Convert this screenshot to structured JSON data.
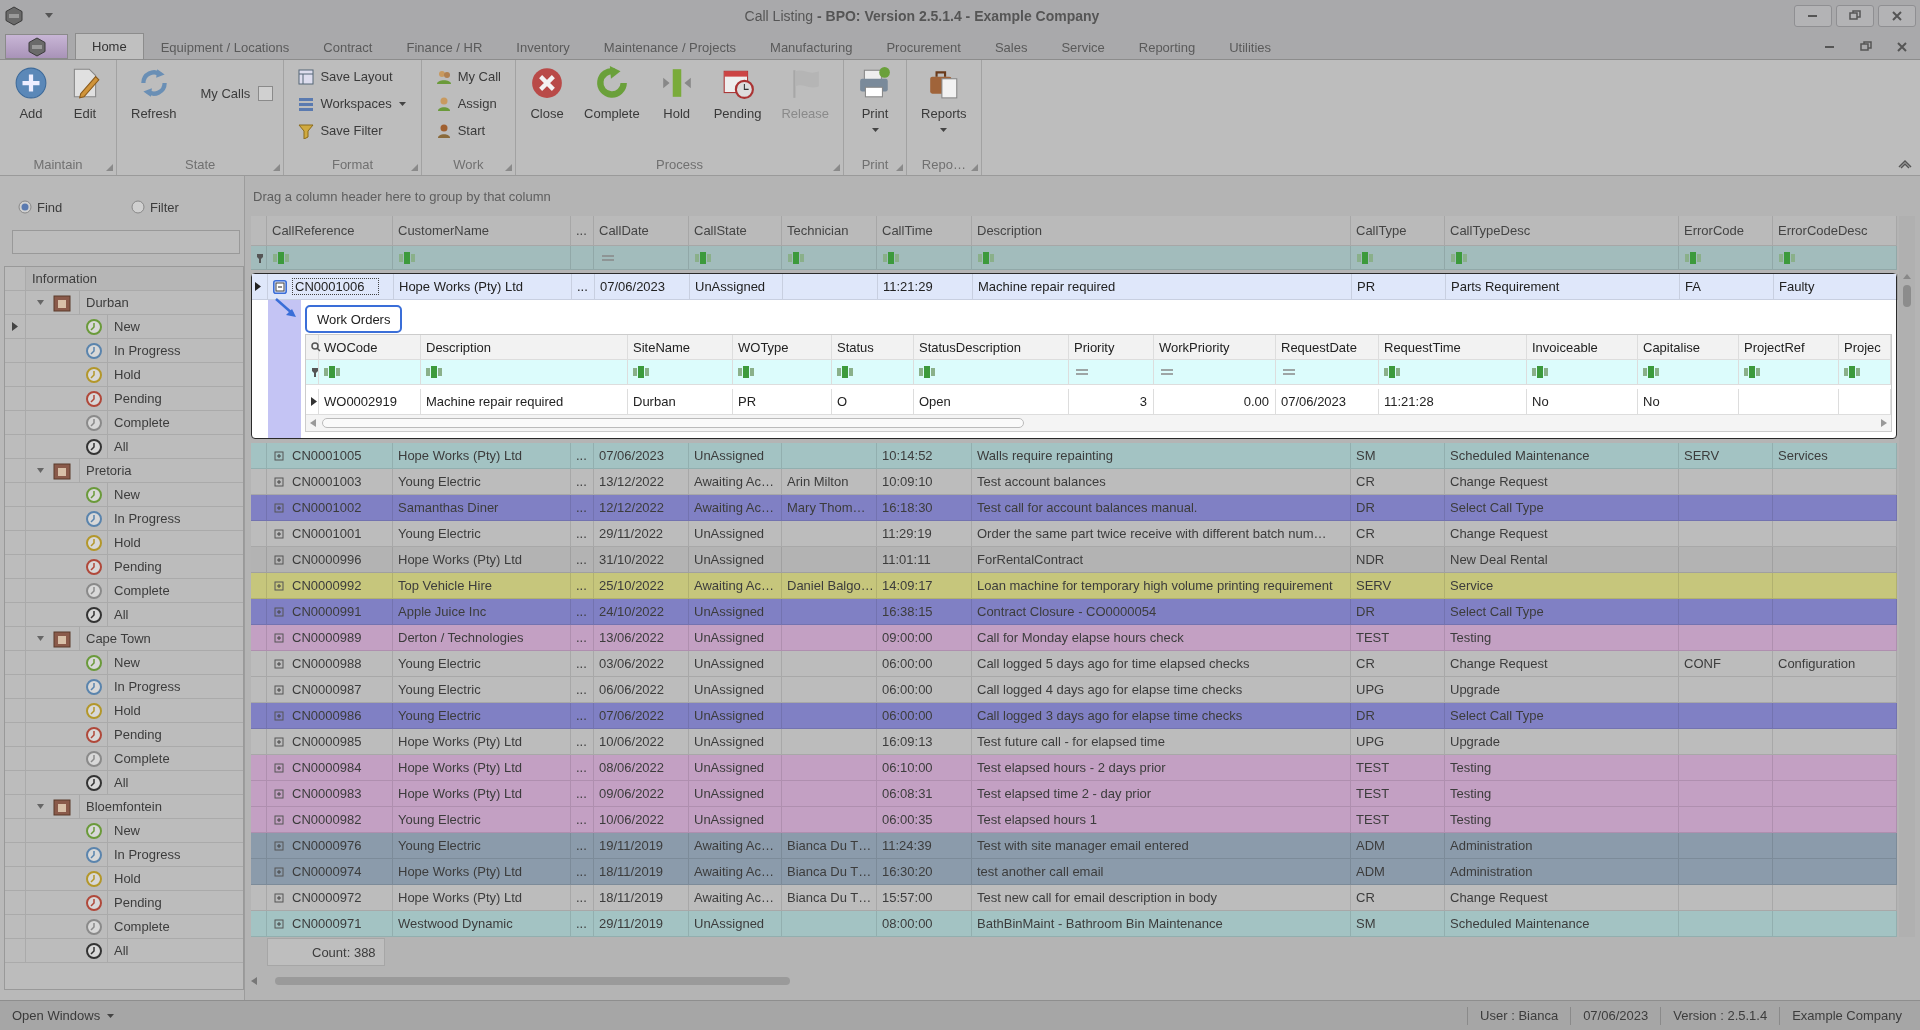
{
  "window": {
    "title": "Call Listing **- BPO: Version 2.5.1.4 - Example Company**"
  },
  "menu_tabs": [
    {
      "label": "Home",
      "selected": true
    },
    {
      "label": "Equipment / Locations",
      "selected": false
    },
    {
      "label": "Contract",
      "selected": false
    },
    {
      "label": "Finance / HR",
      "selected": false
    },
    {
      "label": "Inventory",
      "selected": false
    },
    {
      "label": "Maintenance / Projects",
      "selected": false
    },
    {
      "label": "Manufacturing",
      "selected": false
    },
    {
      "label": "Procurement",
      "selected": false
    },
    {
      "label": "Sales",
      "selected": false
    },
    {
      "label": "Service",
      "selected": false
    },
    {
      "label": "Reporting",
      "selected": false
    },
    {
      "label": "Utilities",
      "selected": false
    }
  ],
  "ribbon": {
    "groups": [
      {
        "label": "Maintain",
        "items": [
          {
            "kind": "large",
            "label": "Add",
            "disabled": false,
            "dropdown": false
          },
          {
            "kind": "large",
            "label": "Edit",
            "disabled": false,
            "dropdown": false
          }
        ]
      },
      {
        "label": "State",
        "items": [
          {
            "kind": "large",
            "label": "Refresh",
            "disabled": false,
            "dropdown": false
          },
          {
            "kind": "checkbox",
            "label": "My Calls",
            "checked": false
          }
        ]
      },
      {
        "label": "Format",
        "items": [
          {
            "kind": "small",
            "label": "Save Layout",
            "disabled": false,
            "dropdown": false
          },
          {
            "kind": "small",
            "label": "Workspaces",
            "disabled": false,
            "dropdown": true
          },
          {
            "kind": "small",
            "label": "Save Filter",
            "disabled": false,
            "dropdown": false
          }
        ]
      },
      {
        "label": "Work",
        "items": [
          {
            "kind": "small",
            "label": "My Call",
            "disabled": false,
            "dropdown": false
          },
          {
            "kind": "small",
            "label": "Assign",
            "disabled": false,
            "dropdown": false
          },
          {
            "kind": "small",
            "label": "Start",
            "disabled": false,
            "dropdown": false
          }
        ]
      },
      {
        "label": "Process",
        "items": [
          {
            "kind": "large",
            "label": "Close",
            "disabled": false,
            "dropdown": false
          },
          {
            "kind": "large",
            "label": "Complete",
            "disabled": false,
            "dropdown": false
          },
          {
            "kind": "large",
            "label": "Hold",
            "disabled": false,
            "dropdown": false
          },
          {
            "kind": "large",
            "label": "Pending",
            "disabled": false,
            "dropdown": false
          },
          {
            "kind": "large",
            "label": "Release",
            "disabled": true,
            "dropdown": false
          }
        ]
      },
      {
        "label": "Print",
        "items": [
          {
            "kind": "large",
            "label": "Print",
            "disabled": false,
            "dropdown": true
          }
        ]
      },
      {
        "label": "Repo…",
        "items": [
          {
            "kind": "large",
            "label": "Reports",
            "disabled": false,
            "dropdown": true
          }
        ]
      }
    ]
  },
  "side_panel": {
    "modes": [
      {
        "label": "Find",
        "selected": true
      },
      {
        "label": "Filter",
        "selected": false
      }
    ],
    "tree": {
      "header": "Information",
      "nodes": [
        {
          "label": "Durban",
          "expanded": true,
          "children": [
            {
              "label": "New",
              "color": "#6a9a3a",
              "selected": true
            },
            {
              "label": "In Progress",
              "color": "#5a84ad",
              "selected": false
            },
            {
              "label": "Hold",
              "color": "#b3972a",
              "selected": false
            },
            {
              "label": "Pending",
              "color": "#b0483a",
              "selected": false
            },
            {
              "label": "Complete",
              "color": "#8a8a8a",
              "selected": false
            },
            {
              "label": "All",
              "color": "#333333",
              "selected": false
            }
          ]
        },
        {
          "label": "Pretoria",
          "expanded": true,
          "children": [
            {
              "label": "New",
              "color": "#6a9a3a",
              "selected": false
            },
            {
              "label": "In Progress",
              "color": "#5a84ad",
              "selected": false
            },
            {
              "label": "Hold",
              "color": "#b3972a",
              "selected": false
            },
            {
              "label": "Pending",
              "color": "#b0483a",
              "selected": false
            },
            {
              "label": "Complete",
              "color": "#8a8a8a",
              "selected": false
            },
            {
              "label": "All",
              "color": "#333333",
              "selected": false
            }
          ]
        },
        {
          "label": "Cape Town",
          "expanded": true,
          "children": [
            {
              "label": "New",
              "color": "#6a9a3a",
              "selected": false
            },
            {
              "label": "In Progress",
              "color": "#5a84ad",
              "selected": false
            },
            {
              "label": "Hold",
              "color": "#b3972a",
              "selected": false
            },
            {
              "label": "Pending",
              "color": "#b0483a",
              "selected": false
            },
            {
              "label": "Complete",
              "color": "#8a8a8a",
              "selected": false
            },
            {
              "label": "All",
              "color": "#333333",
              "selected": false
            }
          ]
        },
        {
          "label": "Bloemfontein",
          "expanded": true,
          "children": [
            {
              "label": "New",
              "color": "#6a9a3a",
              "selected": false
            },
            {
              "label": "In Progress",
              "color": "#5a84ad",
              "selected": false
            },
            {
              "label": "Hold",
              "color": "#b3972a",
              "selected": false
            },
            {
              "label": "Pending",
              "color": "#b0483a",
              "selected": false
            },
            {
              "label": "Complete",
              "color": "#8a8a8a",
              "selected": false
            },
            {
              "label": "All",
              "color": "#333333",
              "selected": false
            }
          ]
        }
      ]
    }
  },
  "grid": {
    "group_hint": "Drag a column header here to group by that column",
    "columns": [
      {
        "label": "CallReference"
      },
      {
        "label": "CustomerName"
      },
      {
        "label": "..."
      },
      {
        "label": "CallDate"
      },
      {
        "label": "CallState"
      },
      {
        "label": "Technician"
      },
      {
        "label": "CallTime"
      },
      {
        "label": "Description"
      },
      {
        "label": "CallType"
      },
      {
        "label": "CallTypeDesc"
      },
      {
        "label": "ErrorCode"
      },
      {
        "label": "ErrorCodeDesc"
      }
    ],
    "filters": [
      {
        "kind": "text"
      },
      {
        "kind": "text"
      },
      {
        "kind": "none"
      },
      {
        "kind": "equals"
      },
      {
        "kind": "text"
      },
      {
        "kind": "text"
      },
      {
        "kind": "text"
      },
      {
        "kind": "text"
      },
      {
        "kind": "text"
      },
      {
        "kind": "text"
      },
      {
        "kind": "text"
      },
      {
        "kind": "text"
      }
    ],
    "rows": [
      {
        "expanded": true,
        "color": "#dfe7fa",
        "cells": {
          "reference": "CN0001006",
          "customer": "Hope Works (Pty) Ltd",
          "more": "...",
          "date": "07/06/2023",
          "state": "UnAssigned",
          "time": "11:21:29",
          "description": "Machine repair required",
          "type": "PR",
          "type_desc": "Parts Requirement",
          "error_code": "FA",
          "error_desc": "Faulty"
        },
        "detail": {
          "tabs": [
            {
              "label": "Work Orders",
              "selected": true
            }
          ],
          "columns": [
            {
              "label": "WOCode"
            },
            {
              "label": "Description"
            },
            {
              "label": "SiteName"
            },
            {
              "label": "WOType"
            },
            {
              "label": "Status"
            },
            {
              "label": "StatusDescription"
            },
            {
              "label": "Priority"
            },
            {
              "label": "WorkPriority"
            },
            {
              "label": "RequestDate"
            },
            {
              "label": "RequestTime"
            },
            {
              "label": "Invoiceable"
            },
            {
              "label": "Capitalise"
            },
            {
              "label": "ProjectRef"
            },
            {
              "label": "Projec"
            }
          ],
          "filters": [
            {
              "kind": "text"
            },
            {
              "kind": "text"
            },
            {
              "kind": "text"
            },
            {
              "kind": "text"
            },
            {
              "kind": "text"
            },
            {
              "kind": "text"
            },
            {
              "kind": "equals"
            },
            {
              "kind": "equals"
            },
            {
              "kind": "equals"
            },
            {
              "kind": "text"
            },
            {
              "kind": "text"
            },
            {
              "kind": "text"
            },
            {
              "kind": "text"
            },
            {
              "kind": "text"
            }
          ],
          "rows": [
            {
              "cells": {
                "wo_code": "WO0002919",
                "description": "Machine repair required",
                "site": "Durban",
                "wo_type": "PR",
                "status": "O",
                "status_desc": "Open",
                "priority": "3",
                "work_priority": "0.00",
                "request_date": "07/06/2023",
                "request_time": "11:21:28",
                "invoiceable": "No",
                "capitalise": "No"
              }
            }
          ]
        }
      },
      {
        "expanded": false,
        "color": "#a3c3c3",
        "cells": {
          "reference": "CN0001005",
          "customer": "Hope Works (Pty) Ltd",
          "more": "...",
          "date": "07/06/2023",
          "state": "UnAssigned",
          "time": "10:14:52",
          "description": "Walls require repainting",
          "type": "SM",
          "type_desc": "Scheduled Maintenance",
          "error_code": "SERV",
          "error_desc": "Services"
        }
      },
      {
        "expanded": false,
        "color": "#bcbcbc",
        "cells": {
          "reference": "CN0001003",
          "customer": "Young Electric",
          "more": "...",
          "date": "13/12/2022",
          "state": "Awaiting Ac…",
          "technician": "Arin Milton",
          "time": "10:09:10",
          "description": "Test account balances",
          "type": "CR",
          "type_desc": "Change Request"
        }
      },
      {
        "expanded": false,
        "color": "#8080c4",
        "cells": {
          "reference": "CN0001002",
          "customer": "Samanthas Diner",
          "more": "...",
          "date": "12/12/2022",
          "state": "Awaiting Ac…",
          "technician": "Mary Thom…",
          "time": "16:18:30",
          "description": "Test call for account balances manual.",
          "type": "DR",
          "type_desc": "Select Call Type"
        }
      },
      {
        "expanded": false,
        "color": "#bcbcbc",
        "cells": {
          "reference": "CN0001001",
          "customer": "Young Electric",
          "more": "...",
          "date": "29/11/2022",
          "state": "UnAssigned",
          "time": "11:29:19",
          "description": "Order the same part twice receive with different batch num…",
          "type": "CR",
          "type_desc": "Change Request"
        }
      },
      {
        "expanded": false,
        "color": "#b3b3b3",
        "cells": {
          "reference": "CN0000996",
          "customer": "Hope Works (Pty) Ltd",
          "more": "...",
          "date": "31/10/2022",
          "state": "UnAssigned",
          "time": "11:01:11",
          "description": "ForRentalContract",
          "type": "NDR",
          "type_desc": "New Deal Rental"
        }
      },
      {
        "expanded": false,
        "color": "#c6c67c",
        "cells": {
          "reference": "CN0000992",
          "customer": "Top Vehicle Hire",
          "more": "...",
          "date": "25/10/2022",
          "state": "Awaiting Ac…",
          "technician": "Daniel Balgo…",
          "time": "14:09:17",
          "description": "Loan machine for temporary high volume printing requirement",
          "type": "SERV",
          "type_desc": "Service"
        }
      },
      {
        "expanded": false,
        "color": "#8080c4",
        "cells": {
          "reference": "CN0000991",
          "customer": "Apple Juice Inc",
          "more": "...",
          "date": "24/10/2022",
          "state": "UnAssigned",
          "time": "16:38:15",
          "description": "Contract Closure - CO0000054",
          "type": "DR",
          "type_desc": "Select Call Type"
        }
      },
      {
        "expanded": false,
        "color": "#c3a0c3",
        "cells": {
          "reference": "CN0000989",
          "customer": "Derton / Technologies",
          "more": "...",
          "date": "13/06/2022",
          "state": "UnAssigned",
          "time": "09:00:00",
          "description": "Call for Monday elapse hours check",
          "type": "TEST",
          "type_desc": "Testing"
        }
      },
      {
        "expanded": false,
        "color": "#bcbcbc",
        "cells": {
          "reference": "CN0000988",
          "customer": "Young Electric",
          "more": "...",
          "date": "03/06/2022",
          "state": "UnAssigned",
          "time": "06:00:00",
          "description": "Call logged 5 days ago for time elapsed checks",
          "type": "CR",
          "type_desc": "Change Request",
          "error_code": "CONF",
          "error_desc": "Configuration"
        }
      },
      {
        "expanded": false,
        "color": "#bcbcbc",
        "cells": {
          "reference": "CN0000987",
          "customer": "Young Electric",
          "more": "...",
          "date": "06/06/2022",
          "state": "UnAssigned",
          "time": "06:00:00",
          "description": "Call logged 4 days ago for elapse time checks",
          "type": "UPG",
          "type_desc": "Upgrade"
        }
      },
      {
        "expanded": false,
        "color": "#8080c4",
        "cells": {
          "reference": "CN0000986",
          "customer": "Young Electric",
          "more": "...",
          "date": "07/06/2022",
          "state": "UnAssigned",
          "time": "06:00:00",
          "description": "Call logged 3 days ago for elapse time checks",
          "type": "DR",
          "type_desc": "Select Call Type"
        }
      },
      {
        "expanded": false,
        "color": "#bcbcbc",
        "cells": {
          "reference": "CN0000985",
          "customer": "Hope Works (Pty) Ltd",
          "more": "...",
          "date": "10/06/2022",
          "state": "UnAssigned",
          "time": "16:09:13",
          "description": "Test future call - for elapsed time",
          "type": "UPG",
          "type_desc": "Upgrade"
        }
      },
      {
        "expanded": false,
        "color": "#c3a0c3",
        "cells": {
          "reference": "CN0000984",
          "customer": "Hope Works (Pty) Ltd",
          "more": "...",
          "date": "08/06/2022",
          "state": "UnAssigned",
          "time": "06:10:00",
          "description": "Test elapsed hours - 2 days prior",
          "type": "TEST",
          "type_desc": "Testing"
        }
      },
      {
        "expanded": false,
        "color": "#c3a0c3",
        "cells": {
          "reference": "CN0000983",
          "customer": "Hope Works (Pty) Ltd",
          "more": "...",
          "date": "09/06/2022",
          "state": "UnAssigned",
          "time": "06:08:31",
          "description": "Test elapsed time 2 - day prior",
          "type": "TEST",
          "type_desc": "Testing"
        }
      },
      {
        "expanded": false,
        "color": "#c3a0c3",
        "cells": {
          "reference": "CN0000982",
          "customer": "Young Electric",
          "more": "...",
          "date": "10/06/2022",
          "state": "UnAssigned",
          "time": "06:00:35",
          "description": "Test elapsed hours 1",
          "type": "TEST",
          "type_desc": "Testing"
        }
      },
      {
        "expanded": false,
        "color": "#8b9bab",
        "cells": {
          "reference": "CN0000976",
          "customer": "Young Electric",
          "more": "...",
          "date": "19/11/2019",
          "state": "Awaiting Ac…",
          "technician": "Bianca Du T…",
          "time": "11:24:39",
          "description": "Test with site manager email entered",
          "type": "ADM",
          "type_desc": "Administration"
        }
      },
      {
        "expanded": false,
        "color": "#8b9bab",
        "cells": {
          "reference": "CN0000974",
          "customer": "Hope Works (Pty) Ltd",
          "more": "...",
          "date": "18/11/2019",
          "state": "Awaiting Ac…",
          "technician": "Bianca Du T…",
          "time": "16:30:20",
          "description": "test another call email",
          "type": "ADM",
          "type_desc": "Administration"
        }
      },
      {
        "expanded": false,
        "color": "#bcbcbc",
        "cells": {
          "reference": "CN0000972",
          "customer": "Hope Works (Pty) Ltd",
          "more": "...",
          "date": "18/11/2019",
          "state": "Awaiting Ac…",
          "technician": "Bianca Du T…",
          "time": "15:57:00",
          "description": "Test new call for email description in body",
          "type": "CR",
          "type_desc": "Change Request"
        }
      },
      {
        "expanded": false,
        "color": "#a3c3c3",
        "cells": {
          "reference": "CN0000971",
          "customer": "Westwood Dynamic",
          "more": "...",
          "date": "29/11/2019",
          "state": "UnAssigned",
          "time": "08:00:00",
          "description": "BathBinMaint - Bathroom Bin Maintenance",
          "type": "SM",
          "type_desc": "Scheduled Maintenance"
        }
      }
    ],
    "count": "Count: 388"
  },
  "status_bar": {
    "open_windows": "Open Windows",
    "items": [
      "User : Bianca",
      "07/06/2023",
      "Version : 2.5.1.4",
      "Example Company"
    ]
  }
}
